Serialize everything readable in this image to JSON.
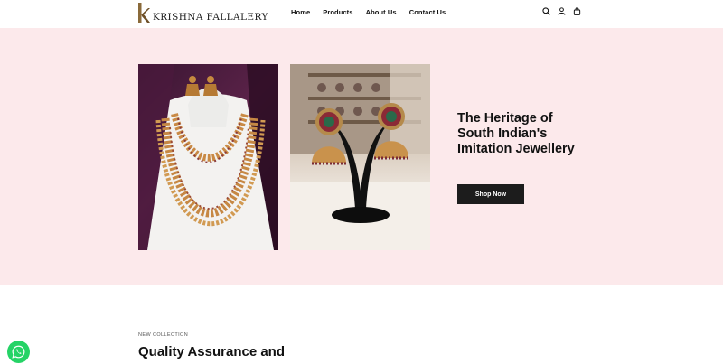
{
  "brand": {
    "logo_letter": "K",
    "name": "KRISHNA FALLALERY"
  },
  "nav": {
    "items": [
      {
        "label": "Home"
      },
      {
        "label": "Products"
      },
      {
        "label": "About Us"
      },
      {
        "label": "Contact Us"
      }
    ]
  },
  "header_icons": [
    "search-icon",
    "user-icon",
    "bag-icon"
  ],
  "hero": {
    "title": "The Heritage of South Indian's Imitation Jewellery",
    "cta_label": "Shop Now",
    "background": "#fce9eb",
    "images": [
      "necklace-set-image",
      "jhumka-earrings-image"
    ]
  },
  "collection": {
    "eyebrow": "NEW COLLECTION",
    "title": "Quality Assurance and"
  },
  "whatsapp": {
    "icon": "whatsapp-icon",
    "color": "#25d366"
  }
}
